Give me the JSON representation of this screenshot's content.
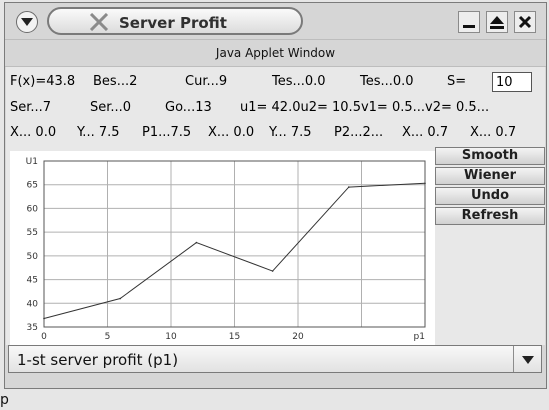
{
  "window": {
    "title": "Server Profit",
    "applet_label": "Java Applet Window"
  },
  "stats": {
    "row1": {
      "fx": "F(x)=43.8",
      "best": "Bes...2",
      "cur": "Cur...9",
      "tes1": "Tes...0.0",
      "tes2": "Tes...0.0",
      "s_label": "S=",
      "s_value": "10"
    },
    "row2": {
      "ser1": "Ser...7",
      "ser2": "Ser...0",
      "go": "Go...13",
      "uv": "u1= 42.0u2= 10.5v1= 0.5...v2= 0.5..."
    },
    "row3": {
      "x1": "X...  0.0",
      "y1": "Y...  7.5",
      "p1": "P1...7.5",
      "x2": "X...  0.0",
      "y2": "Y...  7.5",
      "p2": "P2...2...",
      "x3": "X...  0.7",
      "x4": "X...  0.7"
    }
  },
  "buttons": {
    "smooth": "Smooth",
    "wiener": "Wiener",
    "undo": "Undo",
    "refresh": "Refresh"
  },
  "combo": {
    "selected": "1-st server profit (p1)"
  },
  "footer_text": "p",
  "chart_data": {
    "type": "line",
    "x_ticks": [
      "0",
      "5",
      "10",
      "15",
      "20",
      "p1"
    ],
    "y_ticks": [
      "35",
      "40",
      "45",
      "50",
      "55",
      "60",
      "65",
      "U1"
    ],
    "xlabel": "p1",
    "ylabel": "U1",
    "xlim": [
      0,
      30
    ],
    "ylim": [
      35,
      70
    ],
    "grid": true,
    "series": [
      {
        "x": [
          0,
          6,
          12,
          18,
          24,
          30
        ],
        "y": [
          36.8,
          41.0,
          52.8,
          46.8,
          64.5,
          65.3
        ]
      }
    ],
    "colors": {
      "line": "#333333",
      "grid": "#b0b0b0",
      "frame": "#555555"
    }
  }
}
